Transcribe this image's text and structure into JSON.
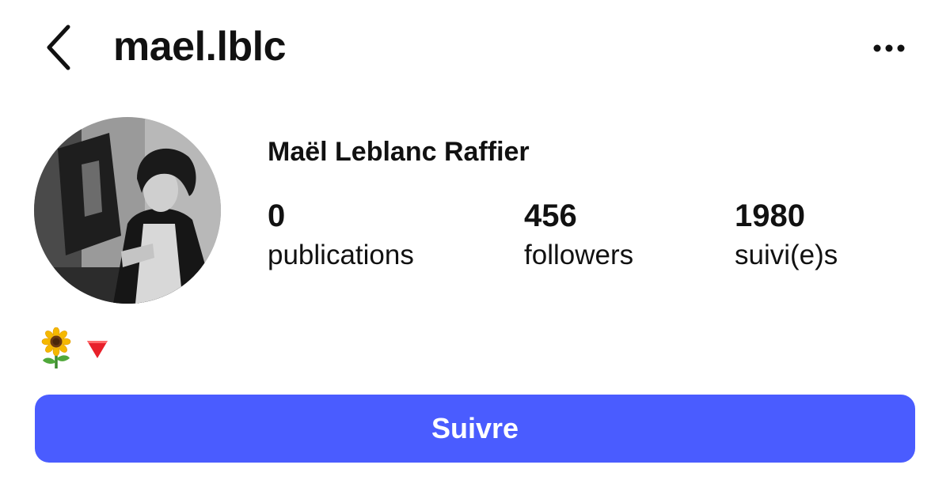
{
  "header": {
    "username": "mael.lblc"
  },
  "profile": {
    "display_name": "Maël Leblanc Raffier",
    "stats": {
      "posts": {
        "count": "0",
        "label": "publications"
      },
      "followers": {
        "count": "456",
        "label": "followers"
      },
      "following": {
        "count": "1980",
        "label": "suivi(e)s"
      }
    },
    "bio_icons": [
      "sunflower-emoji",
      "red-triangle-down-emoji"
    ]
  },
  "actions": {
    "follow_label": "Suivre"
  },
  "colors": {
    "accent": "#4a5cff",
    "text": "#111111",
    "background": "#ffffff"
  }
}
